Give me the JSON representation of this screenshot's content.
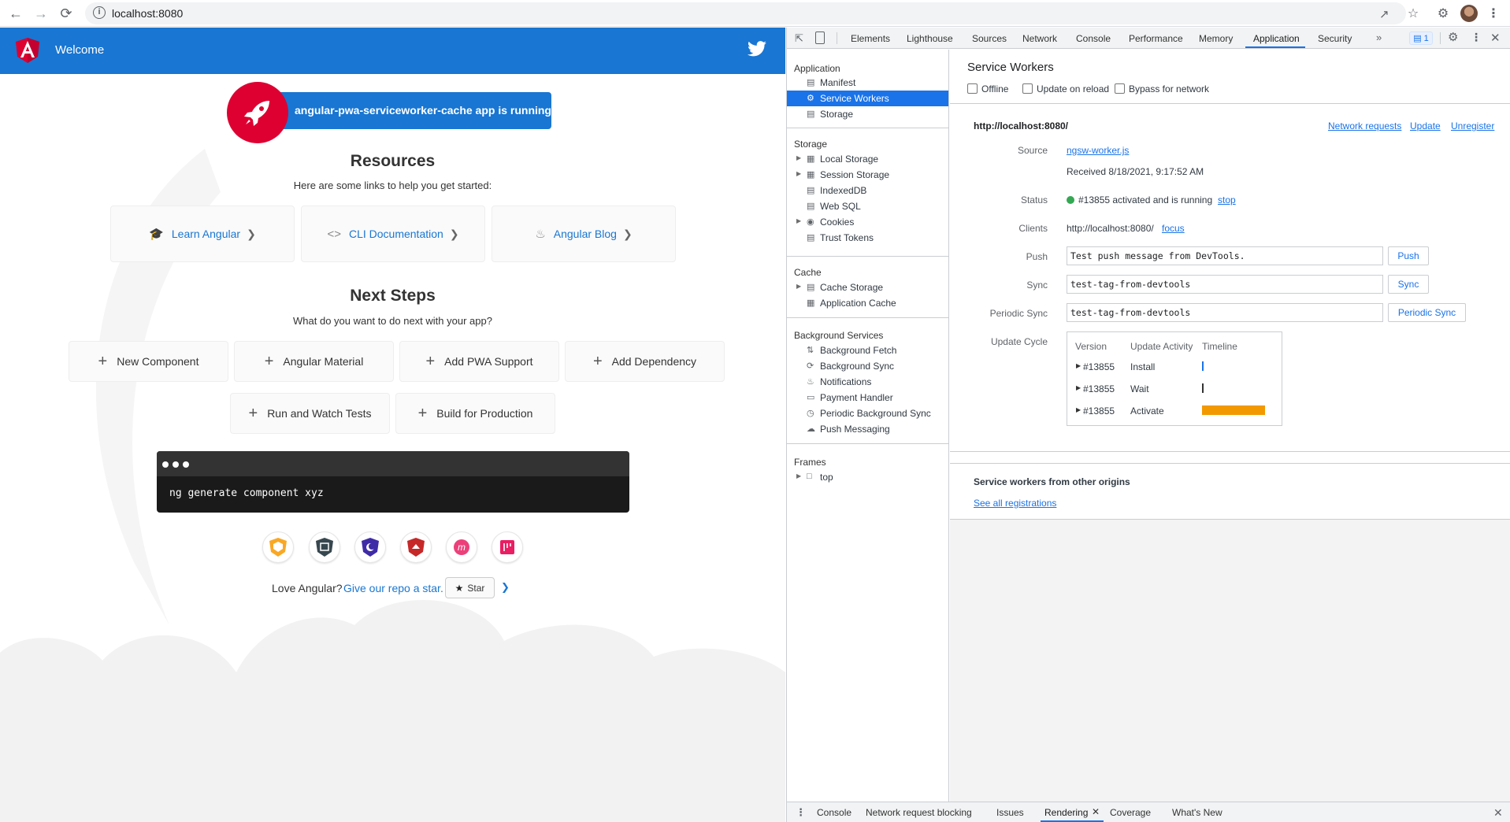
{
  "browser": {
    "url": "localhost:8080",
    "back_icon": "arrow-left-icon",
    "forward_icon": "arrow-right-icon",
    "reload_icon": "reload-icon"
  },
  "app": {
    "toolbar_title": "Welcome",
    "running_banner": "angular-pwa-serviceworker-cache app is running!",
    "resources_title": "Resources",
    "resources_subtitle": "Here are some links to help you get started:",
    "resource_cards": [
      {
        "label": "Learn Angular",
        "icon": "graduation-cap-icon"
      },
      {
        "label": "CLI Documentation",
        "icon": "code-brackets-icon"
      },
      {
        "label": "Angular Blog",
        "icon": "flame-icon"
      }
    ],
    "next_steps_title": "Next Steps",
    "next_steps_subtitle": "What do you want to do next with your app?",
    "step_cards": [
      {
        "label": "New Component"
      },
      {
        "label": "Angular Material"
      },
      {
        "label": "Add PWA Support"
      },
      {
        "label": "Add Dependency"
      },
      {
        "label": "Run and Watch Tests"
      },
      {
        "label": "Build for Production"
      }
    ],
    "terminal_command": "ng generate component xyz",
    "love_text": "Love Angular?",
    "repo_link": "Give our repo a star.",
    "star_label": "Star",
    "colors": {
      "primary": "#1976d2",
      "angular_red": "#dd0031",
      "terminal": "#1a1a1a"
    }
  },
  "devtools": {
    "tabs": [
      "Elements",
      "Lighthouse",
      "Sources",
      "Network",
      "Console",
      "Performance",
      "Memory",
      "Application",
      "Security"
    ],
    "active_tab": "Application",
    "issues_count": "1",
    "sidebar": {
      "application_header": "Application",
      "application_items": [
        "Manifest",
        "Service Workers",
        "Storage"
      ],
      "storage_header": "Storage",
      "storage_items": [
        "Local Storage",
        "Session Storage",
        "IndexedDB",
        "Web SQL",
        "Cookies",
        "Trust Tokens"
      ],
      "cache_header": "Cache",
      "cache_items": [
        "Cache Storage",
        "Application Cache"
      ],
      "bg_header": "Background Services",
      "bg_items": [
        "Background Fetch",
        "Background Sync",
        "Notifications",
        "Payment Handler",
        "Periodic Background Sync",
        "Push Messaging"
      ],
      "frames_header": "Frames",
      "frames_items": [
        "top"
      ]
    },
    "sw": {
      "title": "Service Workers",
      "offline_label": "Offline",
      "update_on_reload_label": "Update on reload",
      "bypass_label": "Bypass for network",
      "origin": "http://localhost:8080/",
      "network_requests_link": "Network requests",
      "update_link": "Update",
      "unregister_link": "Unregister",
      "source_label": "Source",
      "source_file": "ngsw-worker.js",
      "received": "Received 8/18/2021, 9:17:52 AM",
      "status_label": "Status",
      "status_text": "#13855 activated and is running",
      "stop_link": "stop",
      "clients_label": "Clients",
      "clients_value": "http://localhost:8080/",
      "focus_link": "focus",
      "push_label": "Push",
      "push_value": "Test push message from DevTools.",
      "push_button": "Push",
      "sync_label": "Sync",
      "sync_value": "test-tag-from-devtools",
      "sync_button": "Sync",
      "periodic_label": "Periodic Sync",
      "periodic_value": "test-tag-from-devtools",
      "periodic_button": "Periodic Sync",
      "update_cycle_label": "Update Cycle",
      "uc_headers": [
        "Version",
        "Update Activity",
        "Timeline"
      ],
      "uc_rows": [
        {
          "version": "#13855",
          "activity": "Install"
        },
        {
          "version": "#13855",
          "activity": "Wait"
        },
        {
          "version": "#13855",
          "activity": "Activate"
        }
      ],
      "other_origins_title": "Service workers from other origins",
      "see_all_link": "See all registrations"
    },
    "bottom_tabs": [
      "Console",
      "Network request blocking",
      "Issues",
      "Rendering",
      "Coverage",
      "What's New"
    ],
    "active_bottom_tab": "Rendering"
  }
}
